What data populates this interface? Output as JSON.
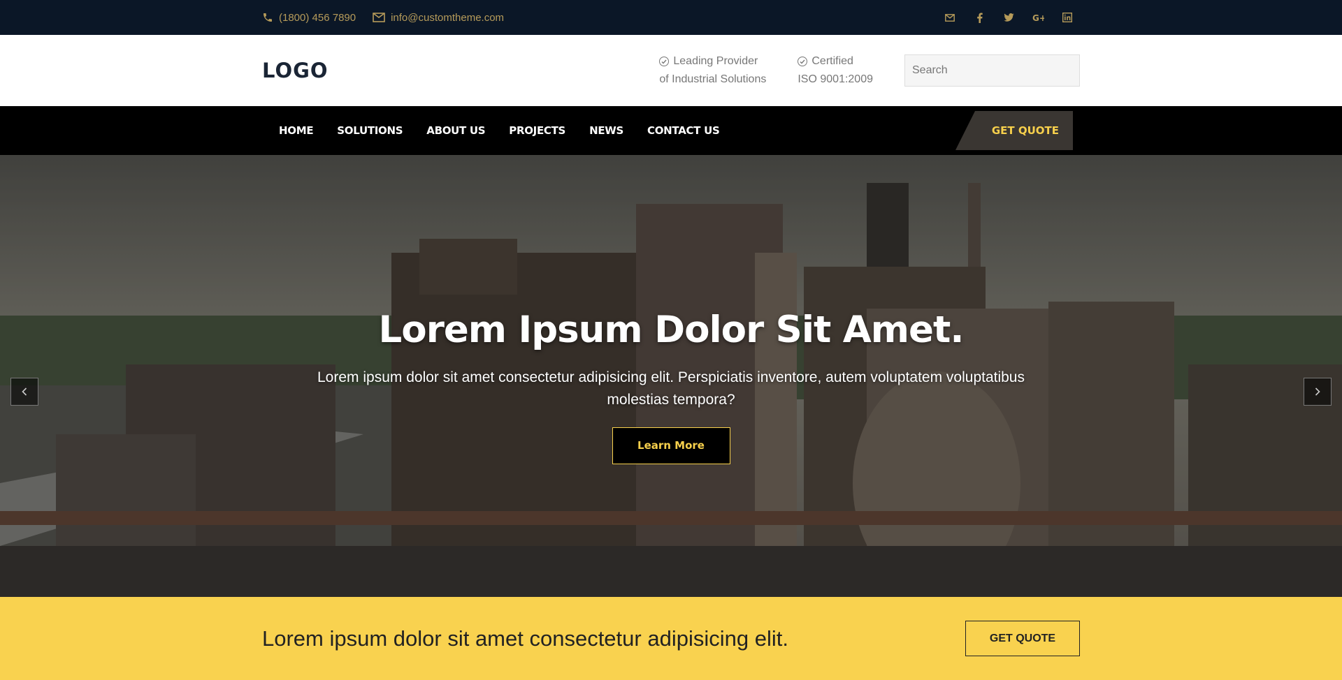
{
  "topbar": {
    "phone": "(1800) 456 7890",
    "email": "info@customtheme.com",
    "social": [
      {
        "icon": "mail-icon",
        "glyph": "✉"
      },
      {
        "icon": "facebook-icon",
        "glyph": "f"
      },
      {
        "icon": "twitter-icon",
        "glyph": "🐦"
      },
      {
        "icon": "google-plus-icon",
        "glyph": "G+"
      },
      {
        "icon": "linkedin-icon",
        "glyph": "in"
      }
    ]
  },
  "header": {
    "logo": "LOGO",
    "info1": {
      "line1": "Leading Provider",
      "line2": "of Industrial Solutions"
    },
    "info2": {
      "line1": "Certified",
      "line2": "ISO 9001:2009"
    },
    "search_placeholder": "Search"
  },
  "nav": {
    "items": [
      "HOME",
      "SOLUTIONS",
      "ABOUT US",
      "PROJECTS",
      "NEWS",
      "CONTACT US"
    ],
    "quote": "GET QUOTE"
  },
  "hero": {
    "title": "Lorem Ipsum Dolor Sit Amet.",
    "subtitle": "Lorem ipsum dolor sit amet consectetur adipisicing elit. Perspiciatis inventore, autem voluptatem voluptatibus molestias tempora?",
    "button": "Learn More"
  },
  "cta": {
    "text": "Lorem ipsum dolor sit amet consectetur adipisicing elit.",
    "button": "GET QUOTE"
  },
  "colors": {
    "topbar_bg": "#0b1727",
    "accent": "#f9d24f",
    "gold_text": "#b69b5a",
    "nav_bg": "#000000"
  }
}
